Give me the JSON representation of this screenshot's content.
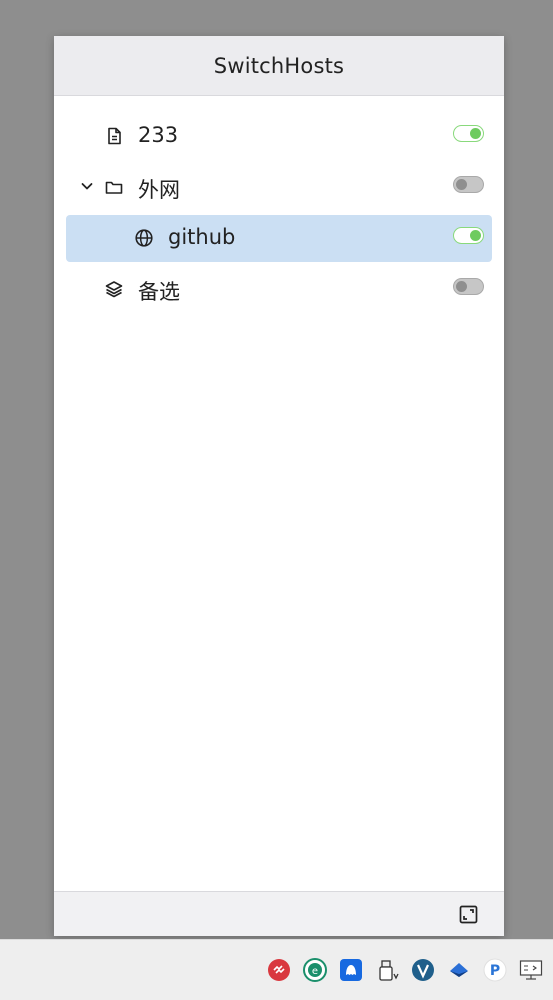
{
  "window": {
    "title": "SwitchHosts"
  },
  "items": [
    {
      "label": "233",
      "icon": "file-icon",
      "enabled": true,
      "selected": false,
      "expandable": false,
      "indent": 0
    },
    {
      "label": "外网",
      "icon": "folder-icon",
      "enabled": false,
      "selected": false,
      "expandable": true,
      "expanded": true,
      "indent": 0
    },
    {
      "label": "github",
      "icon": "globe-icon",
      "enabled": true,
      "selected": true,
      "expandable": false,
      "indent": 1
    },
    {
      "label": "备选",
      "icon": "layers-icon",
      "enabled": false,
      "selected": false,
      "expandable": false,
      "indent": 0
    }
  ],
  "footer": {
    "icon": "resize-icon"
  },
  "taskbar": {
    "tray_icons": [
      "red-app-icon",
      "green-e-icon",
      "blue-app-icon",
      "usb-drive-icon",
      "vscode-like-icon",
      "bird-icon",
      "paypal-like-icon",
      "display-icon"
    ]
  },
  "colors": {
    "selected_bg": "#cbdff3",
    "toggle_on": "#6ecb5f",
    "toggle_off": "#8f8f8f"
  }
}
